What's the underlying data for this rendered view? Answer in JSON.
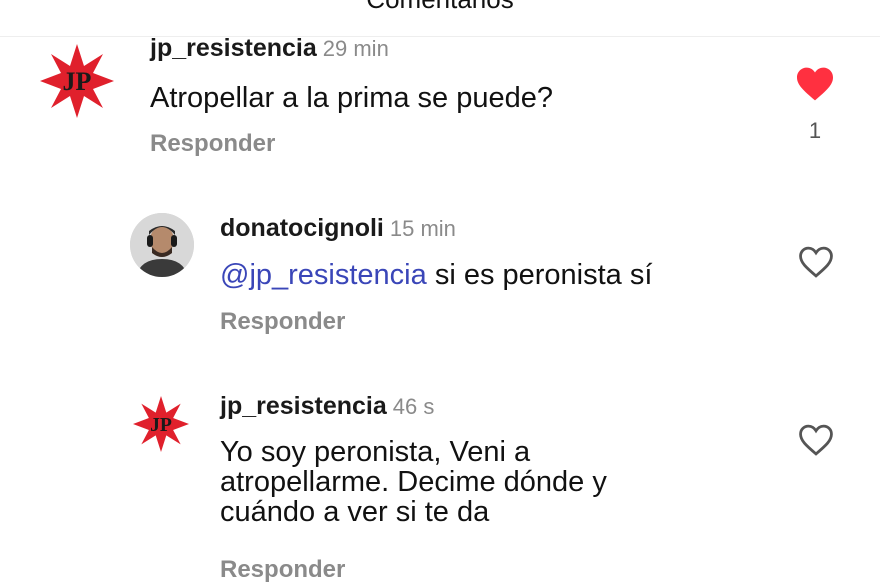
{
  "header": {
    "title": "Comentarios"
  },
  "comments": [
    {
      "username": "jp_resistencia",
      "time": "29 min",
      "text": "Atropellar a la prima se puede?",
      "reply_label": "Responder",
      "liked": true,
      "like_count": "1",
      "avatar_text": "JP"
    },
    {
      "username": "donatocignoli",
      "time": "15 min",
      "mention": "@jp_resistencia",
      "text": " si es peronista sí",
      "reply_label": "Responder",
      "liked": false
    },
    {
      "username": "jp_resistencia",
      "time": "46 s",
      "text_lines": [
        "Yo soy peronista, Veni a",
        "atropellarme. Decime dónde y",
        "cuándo a ver si te da"
      ],
      "reply_label": "Responder",
      "liked": false,
      "avatar_text": "JP"
    }
  ],
  "colors": {
    "like_active": "#ff3040",
    "mention": "#3a46b8",
    "muted": "#8a8a8a"
  }
}
